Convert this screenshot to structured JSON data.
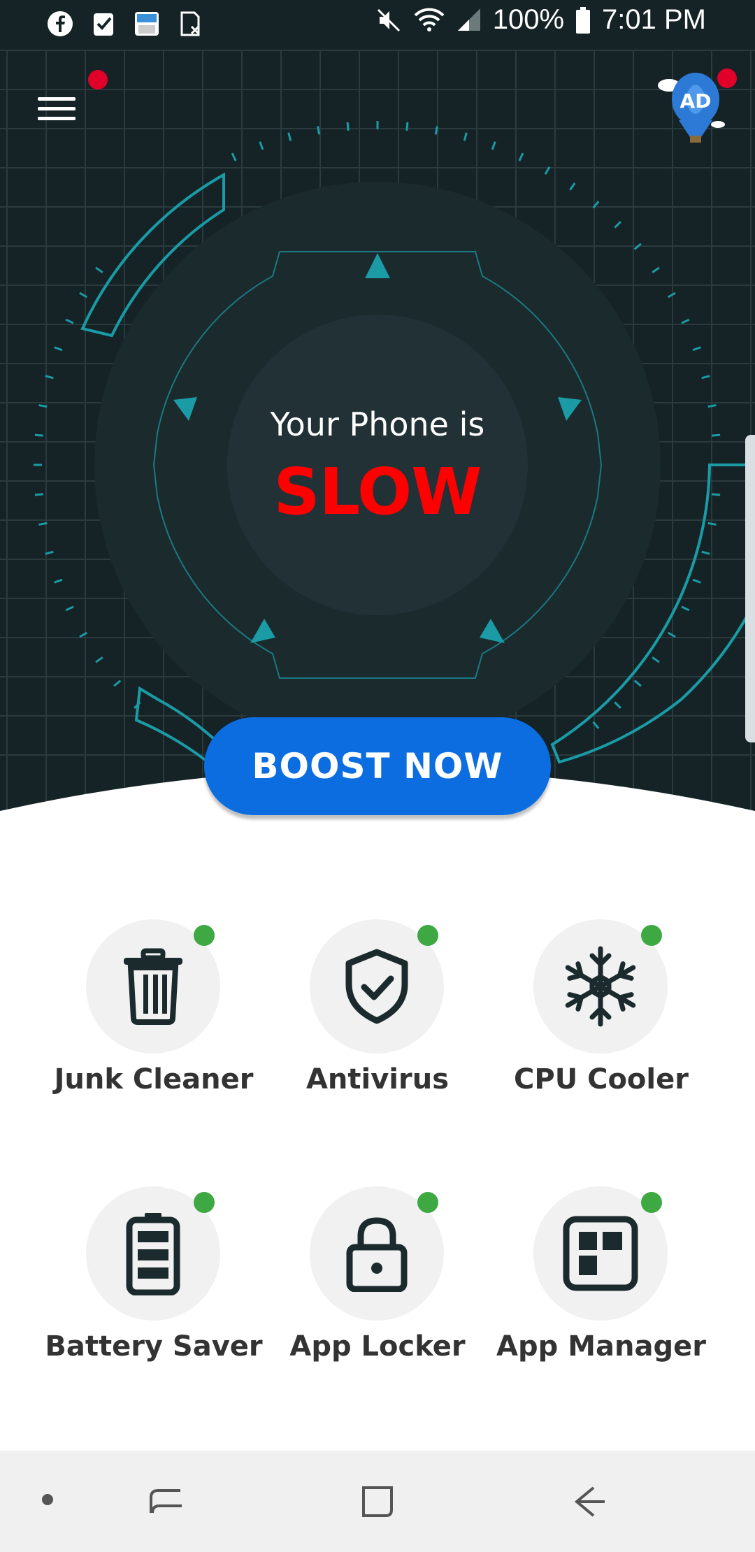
{
  "status_bar": {
    "icons_left": [
      "facebook-icon",
      "checklist-icon",
      "cloud-calendar-icon",
      "sim-icon"
    ],
    "icons_right": [
      "mute-icon",
      "wifi-icon",
      "signal-icon"
    ],
    "battery": "100%",
    "time": "7:01 PM"
  },
  "header": {
    "menu_icon": "hamburger-menu-icon",
    "ad_label": "AD"
  },
  "gauge": {
    "line1": "Your Phone is",
    "line2": "SLOW"
  },
  "boost_button": "BOOST NOW",
  "features": [
    {
      "label": "Junk Cleaner",
      "icon": "trash-icon"
    },
    {
      "label": "Antivirus",
      "icon": "shield-check-icon"
    },
    {
      "label": "CPU Cooler",
      "icon": "snowflake-icon"
    },
    {
      "label": "Battery Saver",
      "icon": "battery-icon"
    },
    {
      "label": "App Locker",
      "icon": "lock-icon"
    },
    {
      "label": "App Manager",
      "icon": "grid-apps-icon"
    }
  ],
  "nav_bar": [
    "dot-icon",
    "recents-icon",
    "home-icon",
    "back-icon"
  ],
  "colors": {
    "hero_bg": "#152326",
    "accent_teal": "#1a9ba6",
    "boost_blue": "#0b6de0",
    "slow_red": "#ff0000",
    "badge_green": "#3ea843"
  }
}
